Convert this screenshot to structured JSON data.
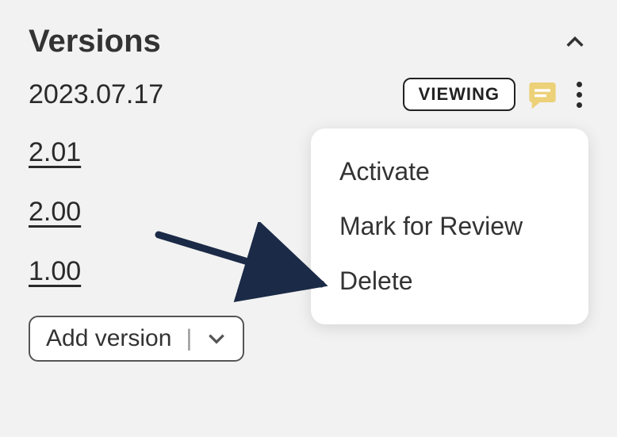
{
  "header": {
    "title": "Versions"
  },
  "currentVersion": {
    "label": "2023.07.17",
    "status": "VIEWING"
  },
  "versions": [
    {
      "label": "2.01"
    },
    {
      "label": "2.00"
    },
    {
      "label": "1.00"
    }
  ],
  "addVersionLabel": "Add version",
  "menu": {
    "items": [
      {
        "label": "Activate"
      },
      {
        "label": "Mark for Review"
      },
      {
        "label": "Delete"
      }
    ]
  }
}
